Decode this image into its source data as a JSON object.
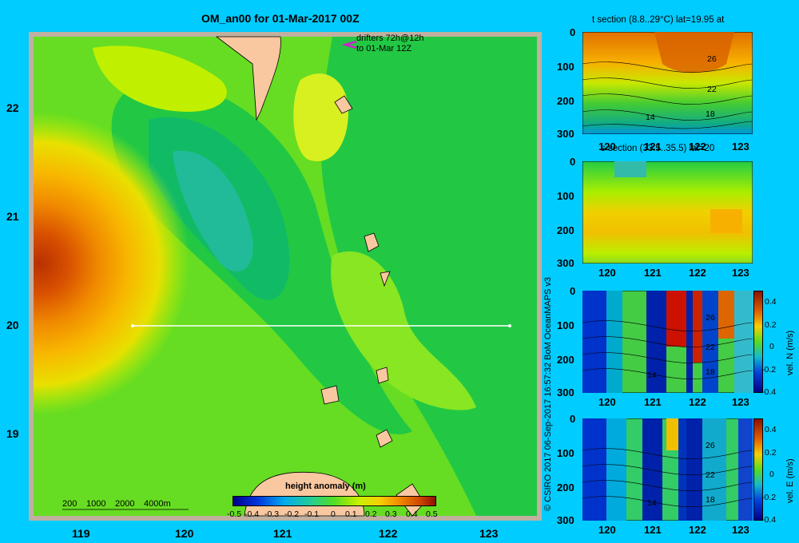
{
  "map": {
    "title": "OM_an00 for 01-Mar-2017 00Z",
    "drifters_line1": "drifters 72h@12h",
    "drifters_line2": "to 01-Mar 12Z",
    "lat_ticks": [
      "22",
      "21",
      "20",
      "19"
    ],
    "lon_ticks": [
      "119",
      "120",
      "121",
      "122",
      "123"
    ],
    "depth_legend": [
      "200",
      "1000",
      "2000",
      "4000m"
    ],
    "section_line_lat": 20,
    "section_line_lon_range": [
      119.5,
      123.2
    ]
  },
  "colorbar": {
    "title": "height anomaly (m)",
    "ticks": [
      "-0.5",
      "-0.4",
      "-0.3",
      "-0.2",
      "-0.1",
      "0",
      "0.1",
      "0.2",
      "0.3",
      "0.4",
      "0.5"
    ],
    "range": [
      -0.5,
      0.5
    ]
  },
  "panels": [
    {
      "title": "t section (8.8..29°C) lat=19.95 at",
      "contour_labels": [
        "26",
        "22",
        "18",
        "14"
      ],
      "colorbar": null
    },
    {
      "title": "s section (33.5..35.5) lat=20",
      "contour_labels": [],
      "colorbar": null
    },
    {
      "title": "",
      "contour_labels": [
        "26",
        "22",
        "18",
        "14"
      ],
      "colorbar": {
        "label": "vel. N (m/s)",
        "ticks": [
          "0.4",
          "0.2",
          "0",
          "-0.2",
          "-0.4"
        ]
      }
    },
    {
      "title": "",
      "contour_labels": [
        "26",
        "22",
        "18",
        "14"
      ],
      "colorbar": {
        "label": "vel. E (m/s)",
        "ticks": [
          "0.4",
          "0.2",
          "0",
          "-0.2",
          "-0.4"
        ]
      }
    }
  ],
  "panel_depth_ticks": [
    "0",
    "100",
    "200",
    "300"
  ],
  "panel_lon_ticks": [
    "120",
    "121",
    "122",
    "123"
  ],
  "credit": "© CSIRO 2017   06-Sep-2017 16:57:32 BoM OceanMAPS v3",
  "colors": {
    "background": "#00ccff",
    "land": "#f9c8a0",
    "shelf": "#b8a898"
  }
}
